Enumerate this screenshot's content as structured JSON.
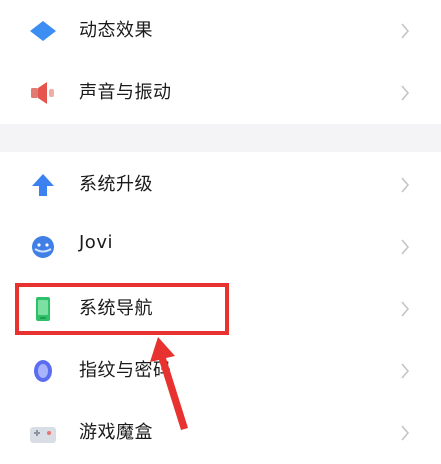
{
  "settings": {
    "items": [
      {
        "label": "动态效果",
        "icon": "diamond-icon"
      },
      {
        "label": "声音与振动",
        "icon": "speaker-icon"
      },
      {
        "label": "系统升级",
        "icon": "upgrade-arrow-icon"
      },
      {
        "label": "Jovi",
        "icon": "jovi-icon"
      },
      {
        "label": "系统导航",
        "icon": "phone-navigation-icon"
      },
      {
        "label": "指纹与密码",
        "icon": "fingerprint-icon"
      },
      {
        "label": "游戏魔盒",
        "icon": "game-box-icon"
      }
    ]
  },
  "annotation": {
    "highlight_color": "#e8322f"
  }
}
